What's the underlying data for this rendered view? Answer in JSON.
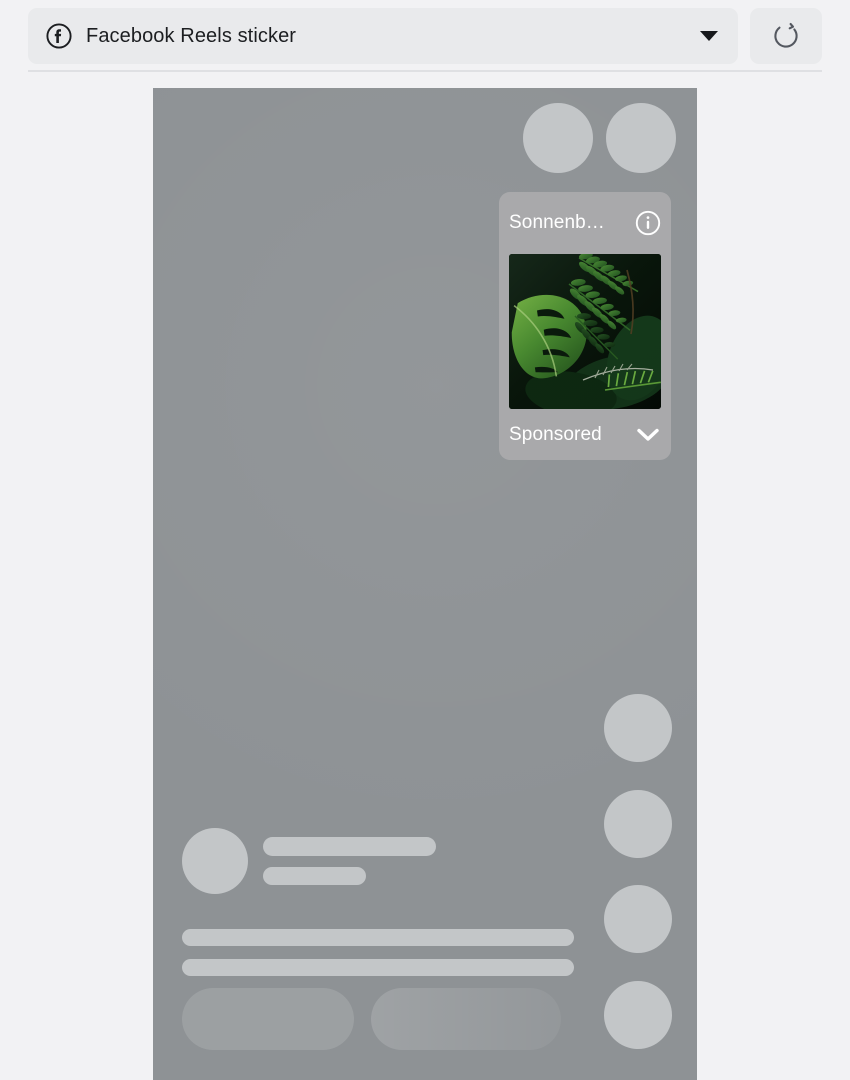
{
  "toolbar": {
    "platform_icon": "facebook-icon",
    "selector_label": "Facebook Reels sticker",
    "dropdown_icon": "caret-down-icon",
    "refresh_icon": "refresh-icon",
    "refresh_title": "Reload preview"
  },
  "preview": {
    "background_color": "#8e9295",
    "skeleton_color": "#c3c6c8",
    "page_background": "#f2f2f4"
  },
  "sticker": {
    "title": "Sonnenb…",
    "info_icon": "info-circle-icon",
    "sponsored_label": "Sponsored",
    "chevron_icon": "chevron-down-icon",
    "card_color": "#a9a9ab",
    "text_color": "#ffffff",
    "image_alt": "tropical green foliage with monstera leaf and fern fronds"
  }
}
